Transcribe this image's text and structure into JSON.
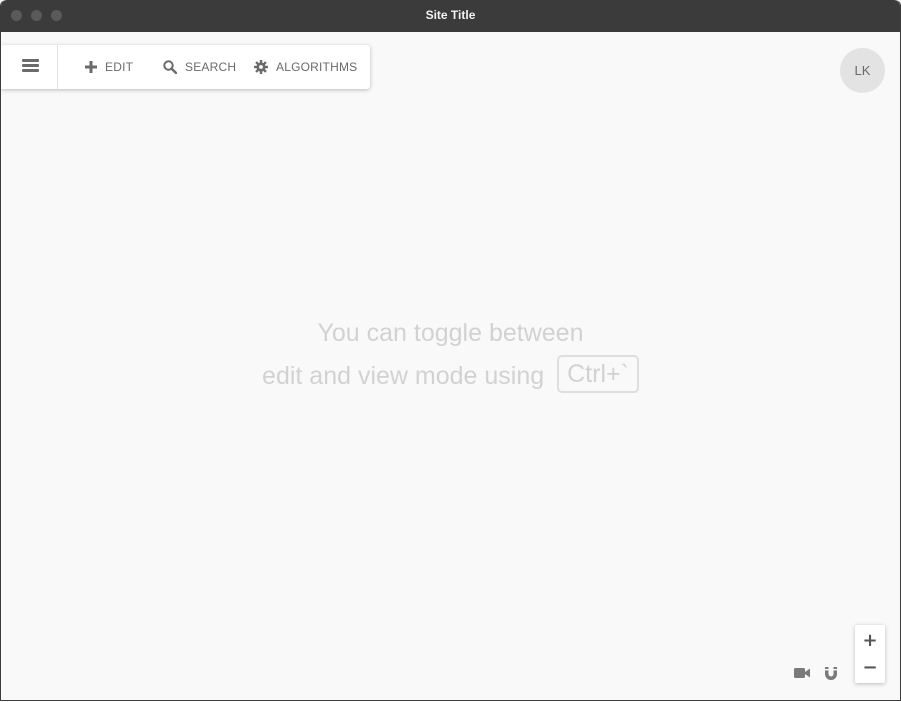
{
  "window": {
    "title": "Site Title"
  },
  "toolbar": {
    "menu_icon": "hamburger-icon",
    "edit_label": "EDIT",
    "edit_icon": "plus-icon",
    "search_label": "SEARCH",
    "search_icon": "search-icon",
    "algorithms_label": "ALGORITHMS",
    "algorithms_icon": "gear-icon"
  },
  "user": {
    "initials": "LK"
  },
  "hint": {
    "line1": "You can toggle between",
    "line2": "edit and view mode using",
    "shortcut": "Ctrl+`"
  },
  "zoom": {
    "in_label": "+",
    "out_label": "−"
  },
  "bottom_icons": [
    "camera-icon",
    "magnet-icon"
  ],
  "colors": {
    "titlebar": "#3b3b3b",
    "background": "#f9f9f9",
    "toolbar_text": "#6b6b6b",
    "hint_text": "#d2d2d2"
  }
}
